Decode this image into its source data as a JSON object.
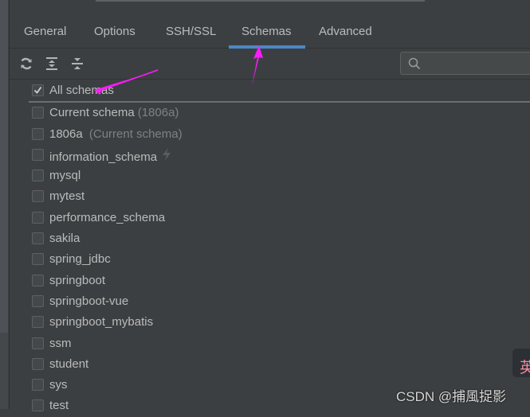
{
  "tabs": [
    {
      "label": "General",
      "active": false
    },
    {
      "label": "Options",
      "active": false
    },
    {
      "label": "SSH/SSL",
      "active": false
    },
    {
      "label": "Schemas",
      "active": true
    },
    {
      "label": "Advanced",
      "active": false
    }
  ],
  "toolbar": {
    "icons": [
      "refresh-icon",
      "expand-all-icon",
      "collapse-all-icon"
    ]
  },
  "search": {
    "value": "",
    "placeholder": ""
  },
  "schemas": [
    {
      "label": "All schemas",
      "hint": "",
      "checked": true
    },
    {
      "label": "Current schema",
      "hint": "(1806a)",
      "checked": false
    },
    {
      "label": "1806a",
      "hint": " (Current schema)",
      "checked": false
    },
    {
      "label": "information_schema",
      "hint": "",
      "checked": false,
      "icon": "lightning-icon"
    },
    {
      "label": "mysql",
      "hint": "",
      "checked": false
    },
    {
      "label": "mytest",
      "hint": "",
      "checked": false
    },
    {
      "label": "performance_schema",
      "hint": "",
      "checked": false
    },
    {
      "label": "sakila",
      "hint": "",
      "checked": false
    },
    {
      "label": "spring_jdbc",
      "hint": "",
      "checked": false
    },
    {
      "label": "springboot",
      "hint": "",
      "checked": false
    },
    {
      "label": "springboot-vue",
      "hint": "",
      "checked": false
    },
    {
      "label": "springboot_mybatis",
      "hint": "",
      "checked": false
    },
    {
      "label": "ssm",
      "hint": "",
      "checked": false
    },
    {
      "label": "student",
      "hint": "",
      "checked": false
    },
    {
      "label": "sys",
      "hint": "",
      "checked": false
    },
    {
      "label": "test",
      "hint": "",
      "checked": false
    }
  ],
  "watermark": "CSDN @捕風捉影",
  "ime_badge": "英",
  "colors": {
    "accent": "#4a88c7",
    "annotation": "#ff1aff",
    "background": "#3c3f41"
  }
}
